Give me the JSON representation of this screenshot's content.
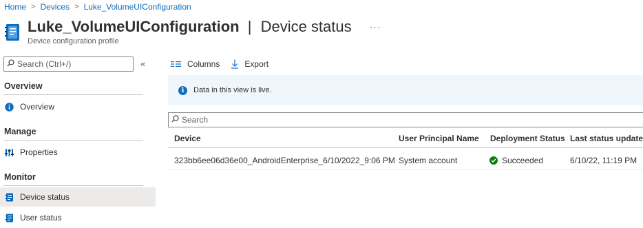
{
  "breadcrumb": [
    "Home",
    "Devices",
    "Luke_VolumeUIConfiguration"
  ],
  "header": {
    "title_main": "Luke_VolumeUIConfiguration",
    "title_separator": "|",
    "title_section": "Device status",
    "more": "···",
    "subtitle": "Device configuration profile"
  },
  "sidebar": {
    "search_placeholder": "Search (Ctrl+/)",
    "collapse": "«",
    "sections": {
      "overview": "Overview",
      "manage": "Manage",
      "monitor": "Monitor"
    },
    "items": {
      "overview": "Overview",
      "properties": "Properties",
      "device_status": "Device status",
      "user_status": "User status"
    }
  },
  "toolbar": {
    "columns": "Columns",
    "export": "Export"
  },
  "info": "Data in this view is live.",
  "grid": {
    "search_placeholder": "Search",
    "headers": [
      "Device",
      "User Principal Name",
      "Deployment Status",
      "Last status update"
    ],
    "rows": [
      {
        "device": "323bb6ee06d36e00_AndroidEnterprise_6/10/2022_9:06 PM",
        "upn": "System account",
        "status": "Succeeded",
        "updated": "6/10/22, 11:19 PM"
      }
    ]
  },
  "colors": {
    "accent": "#0f6cbd",
    "success": "#107c10",
    "info_bg": "#eff6fc",
    "active_nav": "#edebe9"
  }
}
